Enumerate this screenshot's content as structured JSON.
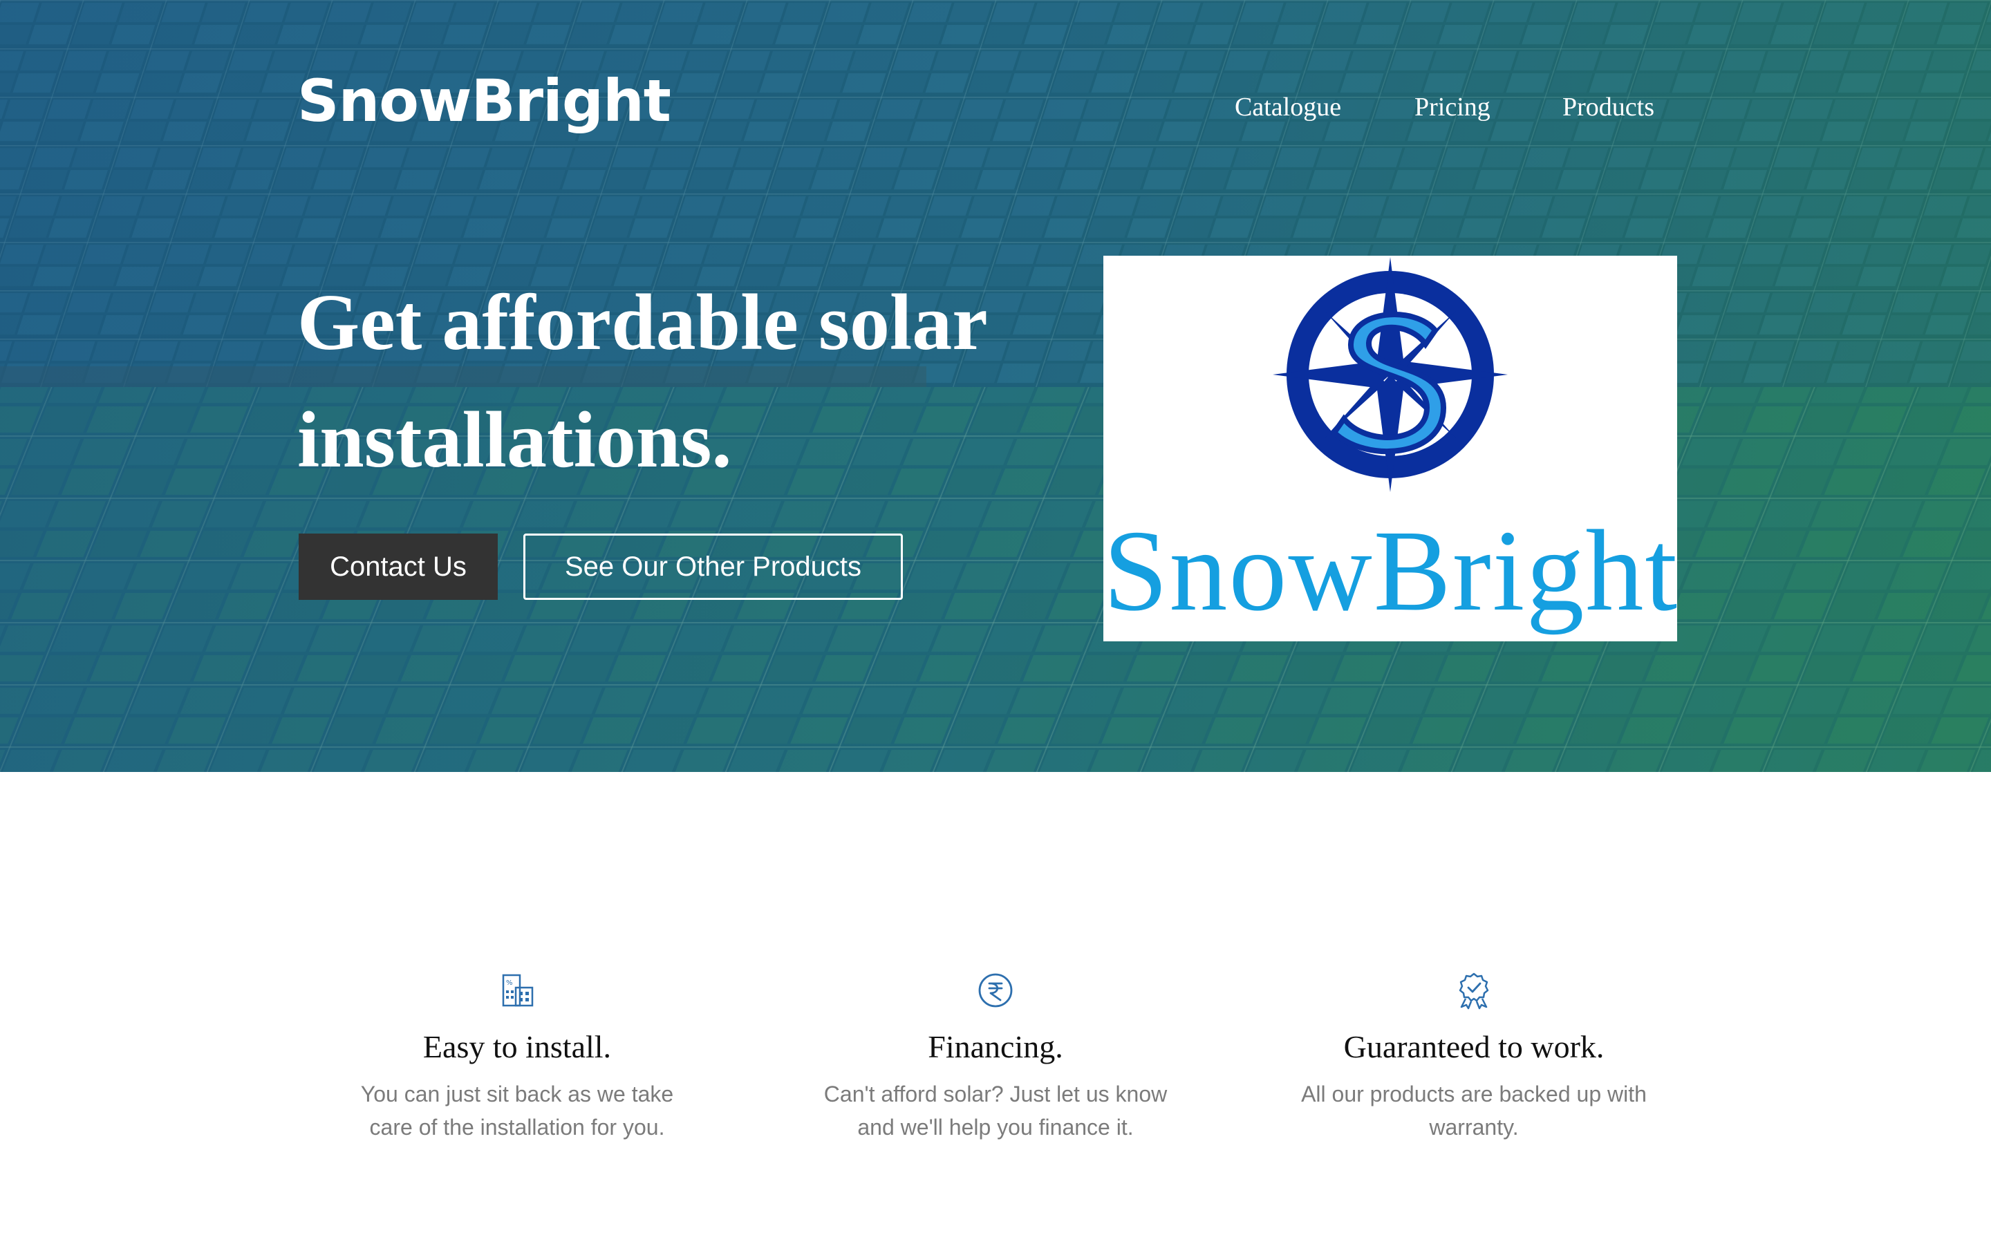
{
  "header": {
    "brand": "SnowBright",
    "nav": [
      {
        "label": "Catalogue"
      },
      {
        "label": "Pricing"
      },
      {
        "label": "Products"
      }
    ]
  },
  "hero": {
    "title": "Get affordable solar installations.",
    "primary_button": "Contact Us",
    "secondary_button": "See Our Other Products",
    "background": "solar-panels-photo"
  },
  "logo": {
    "wordmark": "SnowBright",
    "icon": "compass-s-logo",
    "colors": {
      "navy": "#0a2f9e",
      "cyan": "#159fe0"
    }
  },
  "features": [
    {
      "icon": "building-icon",
      "title": "Easy to install.",
      "description": "You can just sit back as we take care of the installation for you."
    },
    {
      "icon": "rupee-icon",
      "title": "Financing.",
      "description": "Can't afford solar? Just let us know and we'll help you finance it."
    },
    {
      "icon": "award-badge-icon",
      "title": "Guaranteed to work.",
      "description": "All our products are backed up with warranty."
    }
  ],
  "colors": {
    "button_dark": "#333333",
    "icon_blue": "#2d6fae",
    "muted_text": "#7b7b7b"
  }
}
